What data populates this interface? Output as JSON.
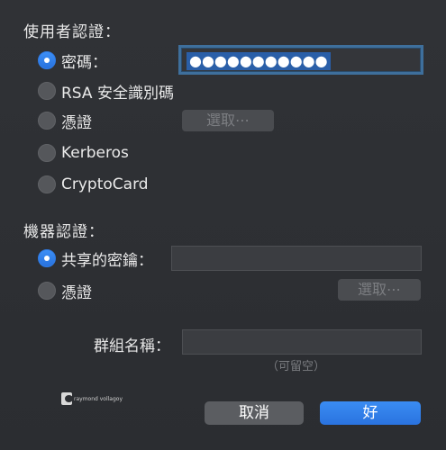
{
  "user_auth": {
    "title": "使用者認證：",
    "options": [
      {
        "label": "密碼：",
        "selected": true
      },
      {
        "label": "RSA 安全識別碼",
        "selected": false
      },
      {
        "label": "憑證",
        "selected": false
      },
      {
        "label": "Kerberos",
        "selected": false
      },
      {
        "label": "CryptoCard",
        "selected": false
      }
    ],
    "password_value": "●●●●●●●●●●●",
    "select_button": "選取⋯"
  },
  "machine_auth": {
    "title": "機器認證：",
    "options": [
      {
        "label": "共享的密鑰：",
        "selected": true
      },
      {
        "label": "憑證",
        "selected": false
      }
    ],
    "shared_secret_value": "",
    "select_button": "選取⋯"
  },
  "group": {
    "label": "群組名稱：",
    "value": "",
    "hint": "（可留空）"
  },
  "buttons": {
    "cancel": "取消",
    "ok": "好"
  },
  "colors": {
    "background": "#2d2f33",
    "accent": "#2f7be6",
    "focus_ring": "#3e6f9c"
  },
  "watermark": {
    "icon": "camera-logo-icon",
    "text": "raymond vollagoy"
  }
}
